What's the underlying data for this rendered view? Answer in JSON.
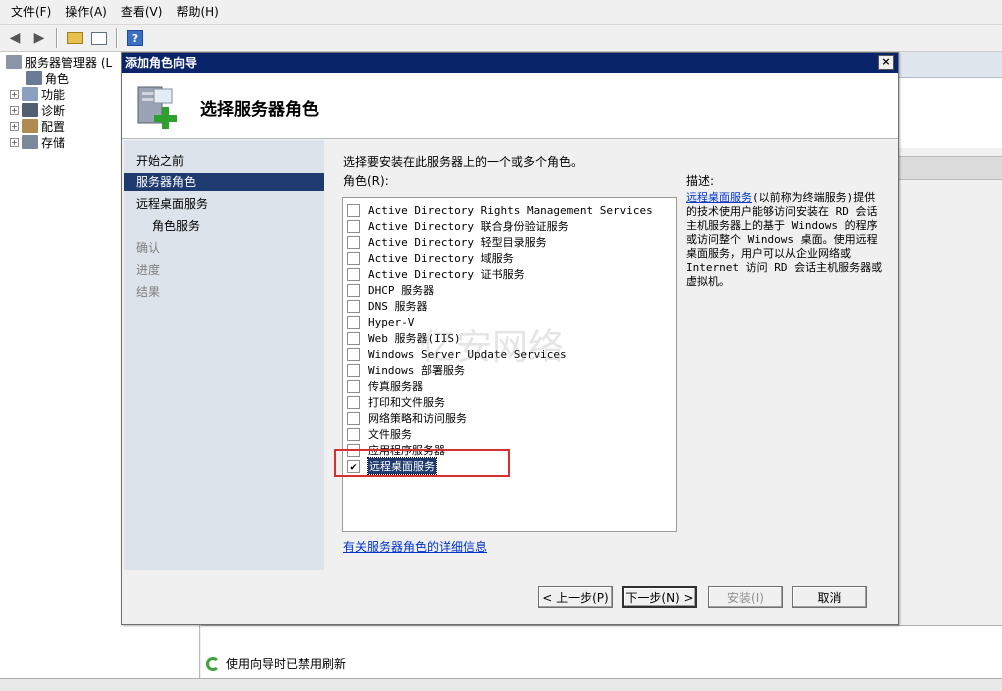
{
  "menu": [
    "文件(F)",
    "操作(A)",
    "查看(V)",
    "帮助(H)"
  ],
  "toolbar": {
    "help_glyph": "?"
  },
  "tree": {
    "root": "服务器管理器 (L",
    "items": [
      "角色",
      "功能",
      "诊断",
      "配置",
      "存储"
    ]
  },
  "status": {
    "text": "使用向导时已禁用刷新"
  },
  "dialog": {
    "title": "添加角色向导",
    "close": "×",
    "header_title": "选择服务器角色",
    "nav": [
      "开始之前",
      "服务器角色",
      "远程桌面服务",
      "角色服务",
      "确认",
      "进度",
      "结果"
    ],
    "instruction": "选择要安装在此服务器上的一个或多个角色。",
    "roles_label": "角色(R):",
    "roles": [
      {
        "name": "Active Directory Rights Management Services",
        "checked": false
      },
      {
        "name": "Active Directory 联合身份验证服务",
        "checked": false
      },
      {
        "name": "Active Directory 轻型目录服务",
        "checked": false
      },
      {
        "name": "Active Directory 域服务",
        "checked": false
      },
      {
        "name": "Active Directory 证书服务",
        "checked": false
      },
      {
        "name": "DHCP 服务器",
        "checked": false
      },
      {
        "name": "DNS 服务器",
        "checked": false
      },
      {
        "name": "Hyper-V",
        "checked": false
      },
      {
        "name": "Web 服务器(IIS)",
        "checked": false
      },
      {
        "name": "Windows Server Update Services",
        "checked": false
      },
      {
        "name": "Windows 部署服务",
        "checked": false
      },
      {
        "name": "传真服务器",
        "checked": false
      },
      {
        "name": "打印和文件服务",
        "checked": false
      },
      {
        "name": "网络策略和访问服务",
        "checked": false
      },
      {
        "name": "文件服务",
        "checked": false
      },
      {
        "name": "应用程序服务器",
        "checked": false
      },
      {
        "name": "远程桌面服务",
        "checked": true
      }
    ],
    "description_label": "描述:",
    "description_link": "远程桌面服务",
    "description_text": "(以前称为终端服务)提供的技术使用户能够访问安装在 RD 会话主机服务器上的基于 Windows 的程序或访问整个 Windows 桌面。使用远程桌面服务，用户可以从企业网络或 Internet 访问 RD 会话主机服务器或虚拟机。",
    "more_info_link": "有关服务器角色的详细信息",
    "buttons": {
      "prev": "< 上一步(P)",
      "next": "下一步(N) >",
      "install": "安装(I)",
      "cancel": "取消"
    }
  },
  "watermark": "亿安网络"
}
